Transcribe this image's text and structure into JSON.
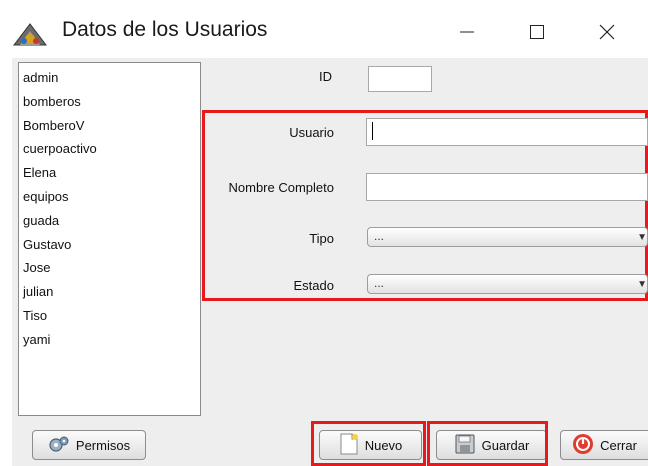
{
  "window": {
    "title": "Datos de los Usuarios"
  },
  "users": [
    "admin",
    "bomberos",
    "BomberoV",
    "cuerpoactivo",
    "Elena",
    "equipos",
    "guada",
    "Gustavo",
    "Jose",
    "julian",
    "Tiso",
    "yami"
  ],
  "form": {
    "id_label": "ID",
    "usuario_label": "Usuario",
    "nombre_label": "Nombre Completo",
    "tipo_label": "Tipo",
    "tipo_value": "...",
    "estado_label": "Estado",
    "estado_value": "..."
  },
  "buttons": {
    "permisos": "Permisos",
    "nuevo": "Nuevo",
    "guardar": "Guardar",
    "cerrar": "Cerrar"
  },
  "colors": {
    "highlight": "#e8191c",
    "panel": "#eeeeee"
  }
}
